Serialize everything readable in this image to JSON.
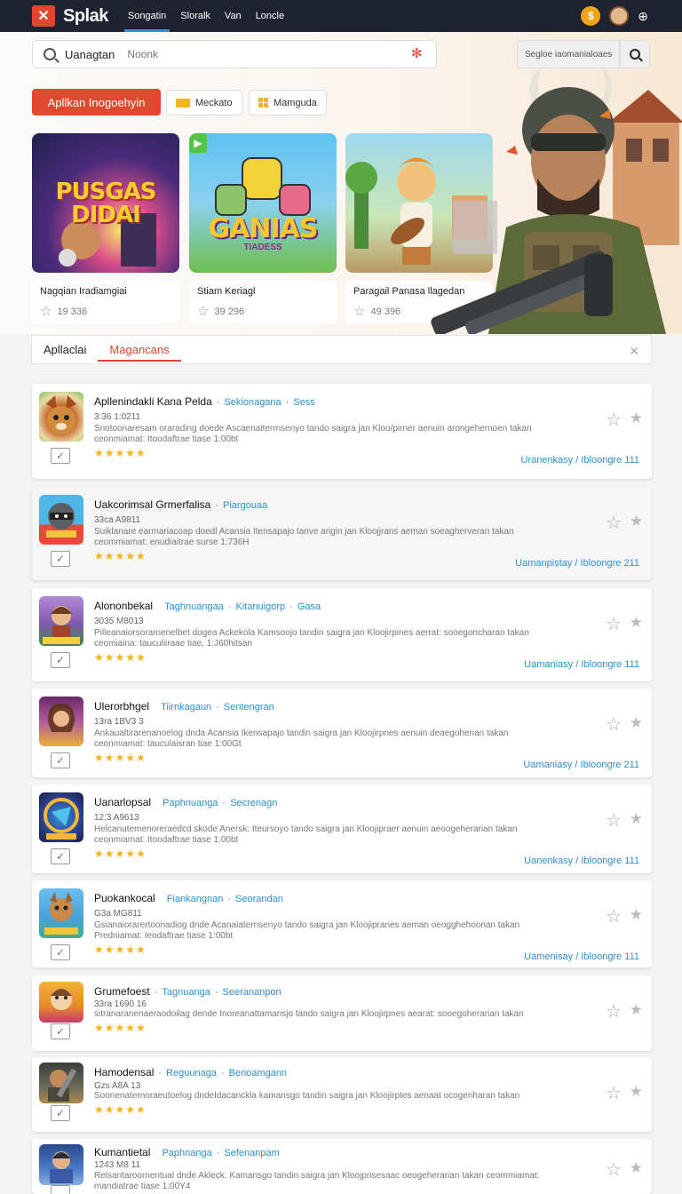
{
  "header": {
    "brand": "Splak",
    "nav": [
      "Songatin",
      "Sloralk",
      "Van",
      "Loncle"
    ]
  },
  "search": {
    "query": "Uanagtan",
    "placeholder": "Noonk",
    "filter_label": "Segloe iaomanialoaes"
  },
  "categories": {
    "active": "Apllkan Inogoehyin",
    "others": [
      "Meckato",
      "Mamguda"
    ]
  },
  "featured": [
    {
      "art_title": "PUSGAS\nDIDAI",
      "title": "Nagqian Iradiamgiai",
      "rating": "19 336"
    },
    {
      "art_title": "GANIAS",
      "art_sub": "TIADESS",
      "title": "Stiam Keriagl",
      "rating": "39 296"
    },
    {
      "title": "Paragail Panasa llagedan",
      "rating": "49 396"
    }
  ],
  "tabs": [
    "Apllaclai",
    "Magancans"
  ],
  "apps": [
    {
      "name": "Apllenindakli Kana Pelda",
      "cat1": "Sekionagana",
      "cat2": "Sess",
      "meta": "3:36 1:0211",
      "desc": "Sriotoonaresam orarading doede Ascaenaiterrnsenyo tando saigra jan Kloo/pirner aenuin arongehernoen takan ceonmiamat: Itoodaftrae tiase 1:00bt",
      "link": "Uranenkasy / Ibloongre 111"
    },
    {
      "name": "Uakcorimsal Grmerfalisa",
      "cat1": "Piargouaa",
      "cat2": "",
      "meta": "33ca A9811",
      "desc": "Suiklanare earmariacoap doedl Acansia Itensapajo tanve arigin jan Kloojjrans aeman soeagherveran takan ceommiamat: enudiaitrae surse 1:736H",
      "link": "Uamanpistay / Ibloongre 211"
    },
    {
      "name": "Alononbekal",
      "cat1": "Taghnuangaa",
      "cat2": "Kitanuigorp",
      "cat3": "Gasa",
      "meta": "3035 M8013",
      "desc": "Pilleanaiorsorarnenelbet dogea Ackekola Kamsoojo tandin saigra jan Kloojirpines aerrat: sooegoncharan takan ceomiaina: tauculiiraae tiae, 1:J60hitsan",
      "link": "Uamaniasy / Ibloongre 111"
    },
    {
      "name": "Ulerorbhgel",
      "cat1": "Tiirnkagaun",
      "cat2": "Sentengran",
      "meta": "13ra 1BV3 3",
      "desc": "Ankaualtirarenanoelog dnda Acansia Ikensapajo tandin saigra jan Kloojirpnes aenuin deaegohenan takan ceonmiamat: tauculaisran tiae 1:00Gt",
      "link": "Uamaniasy / Ibloongre 211"
    },
    {
      "name": "Uanarlopsal",
      "cat1": "Paphnuanga",
      "cat2": "Secrenagn",
      "meta": "12:3 A9613",
      "desc": "Helcanutemenoreraedcd skode Anersk: Iteursoyo tando saigra jan Kloojipraer aenuin aeoogeherarian takan ceonmiamat: Itoodaftrae tiase 1:00bt",
      "link": "Uanenkasy / Ibloongre 111"
    },
    {
      "name": "Puokankocal",
      "cat1": "Fiankangnan",
      "cat2": "Seorandan",
      "meta": "G3a MG811",
      "desc": "Gsianaiorarertoonadiog dnde Acanaiaternsenyo tando saigra jan Kloojipranes aeman oeogghehoonan takan Predniamat: Ieodaftrae tiase 1:00bt",
      "link": "Uamenisay / Ibloongre 111"
    },
    {
      "name": "Grumefoest",
      "cat1": "Tagnuanga",
      "cat2": "Seerananpon",
      "meta": "33ra 1690 16",
      "desc": "sitranaranenaeraodoilag dende Inoreanattamansjo tando saigra jan Kloojirpnes aearat: sooegoherarian takan",
      "link": ""
    },
    {
      "name": "Hamodensal",
      "cat1": "Reguunaga",
      "cat2": "Benoamgann",
      "meta": "Gzs A8A 13",
      "desc": "Soonenaternoraeutoelog dndeIdacanckla kamansgo tandin saigra jan Kloojirptes aenaat ocogenharan takan",
      "link": ""
    },
    {
      "name": "Kumantietal",
      "cat1": "Paphnanga",
      "cat2": "Sefenanpam",
      "meta": "1243 M8 11",
      "desc": "Relsantaroornentual dnde Akleck: Kamansgo tandin saigra jan Kloojprisesaac oeogeherarian takan ceommiamat: mandiatrae tiase 1:00Y4",
      "link": ""
    }
  ]
}
